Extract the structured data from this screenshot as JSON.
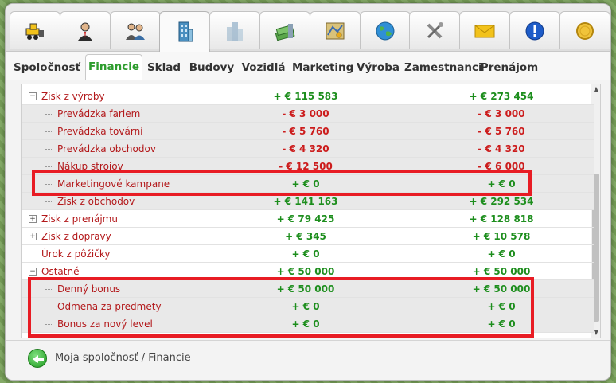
{
  "toolbar": {
    "buttons": [
      {
        "name": "bulldozer-icon"
      },
      {
        "name": "businessman-icon"
      },
      {
        "name": "people-icon"
      },
      {
        "name": "office-building-icon",
        "active": true
      },
      {
        "name": "skyscrapers-icon"
      },
      {
        "name": "money-stack-icon"
      },
      {
        "name": "map-key-icon"
      },
      {
        "name": "globe-icon"
      },
      {
        "name": "tools-icon"
      },
      {
        "name": "envelope-icon"
      },
      {
        "name": "info-icon"
      },
      {
        "name": "coin-icon"
      }
    ]
  },
  "tabs": [
    "Spoločnosť",
    "Financie",
    "Sklad",
    "Budovy",
    "Vozidlá",
    "Marketing",
    "Výroba",
    "Zamestnanci",
    "Prenájom"
  ],
  "active_tab": "Financie",
  "rows": [
    {
      "label": "Zisk z výroby",
      "level": 0,
      "toggle": "−",
      "v1": "+ € 115 583",
      "v2": "+ € 273 454"
    },
    {
      "label": "Prevádzka fariem",
      "level": 1,
      "v1": "- € 3 000",
      "v2": "- € 3 000"
    },
    {
      "label": "Prevádzka tovární",
      "level": 1,
      "v1": "- € 5 760",
      "v2": "- € 5 760"
    },
    {
      "label": "Prevádzka obchodov",
      "level": 1,
      "v1": "- € 4 320",
      "v2": "- € 4 320"
    },
    {
      "label": "Nákup strojov",
      "level": 1,
      "v1": "- € 12 500",
      "v2": "- € 6 000"
    },
    {
      "label": "Marketingové kampane",
      "level": 1,
      "v1": "+ € 0",
      "v2": "+ € 0"
    },
    {
      "label": "Zisk z obchodov",
      "level": 1,
      "v1": "+ € 141 163",
      "v2": "+ € 292 534"
    },
    {
      "label": "Zisk z prenájmu",
      "level": 0,
      "toggle": "+",
      "v1": "+ € 79 425",
      "v2": "+ € 128 818"
    },
    {
      "label": "Zisk z dopravy",
      "level": 0,
      "toggle": "+",
      "v1": "+ € 345",
      "v2": "+ € 10 578"
    },
    {
      "label": "Úrok z pôžičky",
      "level": 0,
      "v1": "+ € 0",
      "v2": "+ € 0"
    },
    {
      "label": "Ostatné",
      "level": 0,
      "toggle": "−",
      "v1": "+ € 50 000",
      "v2": "+ € 50 000"
    },
    {
      "label": "Denný bonus",
      "level": 1,
      "v1": "+ € 50 000",
      "v2": "+ € 50 000"
    },
    {
      "label": "Odmena za predmety",
      "level": 1,
      "v1": "+ € 0",
      "v2": "+ € 0"
    },
    {
      "label": "Bonus za nový level",
      "level": 1,
      "v1": "+ € 0",
      "v2": "+ € 0"
    }
  ],
  "footer": {
    "breadcrumb": "Moja spoločnosť / Financie"
  },
  "colors": {
    "positive": "#1d8e1d",
    "negative": "#cc1c1c",
    "label": "#b3191b",
    "highlight": "#e81c24",
    "active_tab": "#2d9c2d"
  }
}
